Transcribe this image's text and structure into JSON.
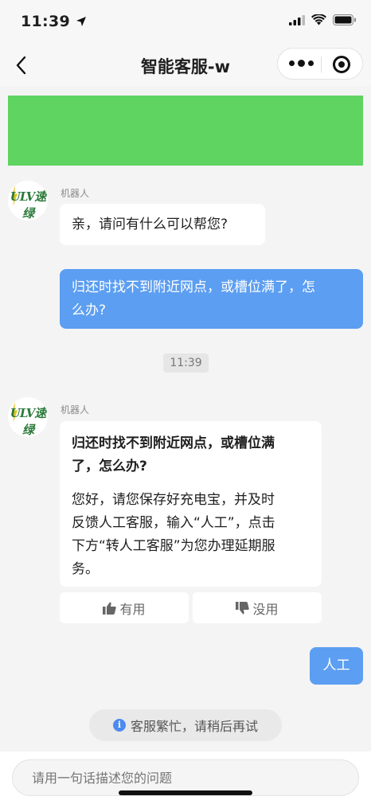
{
  "status_bar": {
    "time": "11:39"
  },
  "nav": {
    "title": "智能客服-w"
  },
  "messages": {
    "bot_name_1": "机器人",
    "greeting": "亲，请问有什么可以帮您?",
    "user_question_line1": "归还时找不到附近网点，或槽位满了，怎",
    "user_question_line2": "么办?",
    "timestamp": "11:39",
    "bot_name_2": "机器人",
    "answer_title_line1": "归还时找不到附近网点，或槽位满",
    "answer_title_line2": "了，怎么办?",
    "answer_body_line1": "您好，请您保存好充电宝，并及时",
    "answer_body_line2": "反馈人工客服，输入“人工”，点击",
    "answer_body_line3": "下方“转人工客服”为您办理延期服",
    "answer_body_line4": "务。",
    "useful_label": "有用",
    "useless_label": "没用",
    "user_reply": "人工"
  },
  "notice": {
    "text": "客服繁忙，请稍后再试",
    "icon": "info-icon"
  },
  "input": {
    "placeholder": "请用一句话描述您的问题"
  },
  "colors": {
    "accent_blue": "#5c9ef1",
    "banner_green": "#5fd461"
  }
}
